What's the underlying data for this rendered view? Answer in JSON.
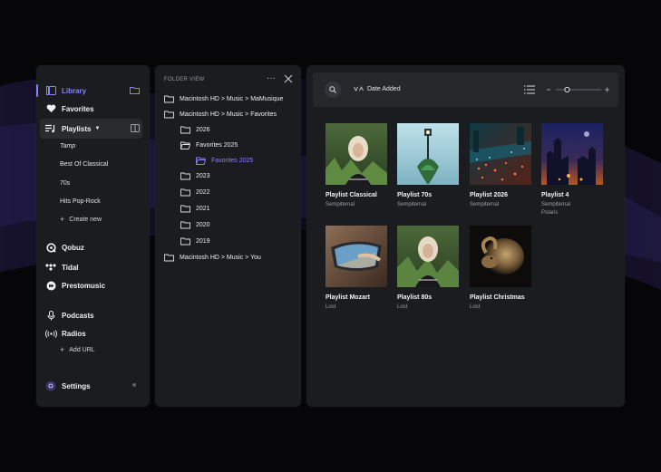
{
  "sidebar": {
    "library": "Library",
    "favorites": "Favorites",
    "playlists": "Playlists",
    "playlist_items": [
      "Tamp",
      "Best Of Classical",
      "70s",
      "Hits Pop-Rock"
    ],
    "create_new": "Create new",
    "services": [
      "Qobuz",
      "Tidal",
      "Prestomusic"
    ],
    "podcasts": "Podcasts",
    "radios": "Radios",
    "add_url": "Add URL",
    "settings": "Settings"
  },
  "folder_view": {
    "title": "FOLDER VIEW",
    "rows": [
      "Macintosh HD > Music > MaMusique",
      "Macintosh HD > Music > Favorites",
      "2026",
      "Favorites 2025",
      "Favorites 2025",
      "2023",
      "2022",
      "2021",
      "2020",
      "2019",
      "Macintosh HD > Music > You"
    ]
  },
  "toolbar": {
    "sort_label": "Date Added",
    "zoom_level": 0.25
  },
  "cards": [
    {
      "title": "Playlist Classical",
      "sub": [
        "Sempiternal"
      ]
    },
    {
      "title": "Playlist 70s",
      "sub": [
        "Sempiternal"
      ]
    },
    {
      "title": "Playlist 2026",
      "sub": [
        "Sempiternal"
      ]
    },
    {
      "title": "Playlist 4",
      "sub": [
        "Sempiternal",
        "Polaris"
      ]
    },
    {
      "title": "Playlist Mozart",
      "sub": [
        "Lost"
      ]
    },
    {
      "title": "Playlist 80s",
      "sub": [
        "Lost"
      ]
    },
    {
      "title": "Playlist Christmas",
      "sub": [
        "Lost"
      ]
    }
  ],
  "colors": {
    "accent": "#8b82ff",
    "panel": "#1b1c1f",
    "background": "#060608"
  }
}
